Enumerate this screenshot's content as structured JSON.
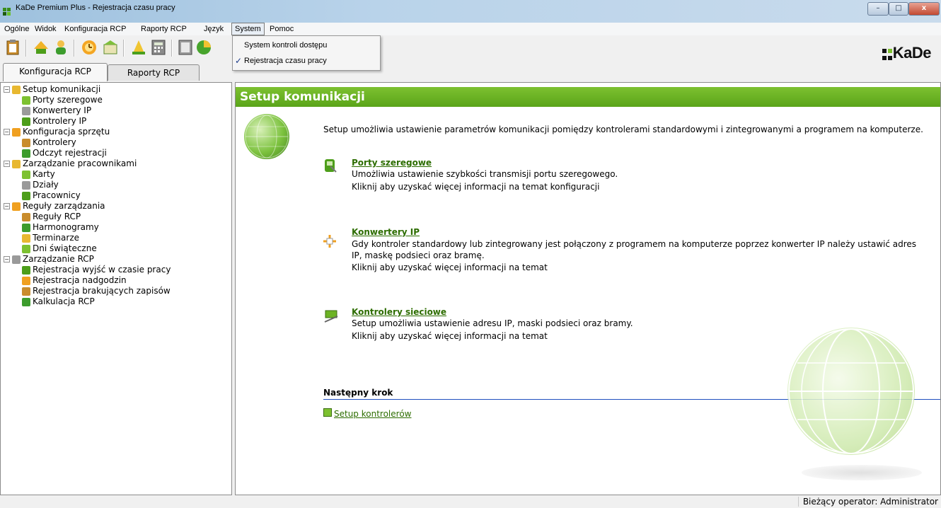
{
  "window": {
    "title": "KaDe Premium Plus - Rejestracja czasu pracy",
    "minimize": "–",
    "maximize": "□",
    "close": "x"
  },
  "menu": {
    "items": [
      "Ogólne",
      "Widok",
      "Konfiguracja RCP",
      "Raporty RCP",
      "Język",
      "System",
      "Pomoc"
    ],
    "open_item": "System",
    "dropdown": [
      {
        "label": "System kontroli dostępu",
        "checked": false
      },
      {
        "label": "Rejestracja czasu pracy",
        "checked": true,
        "check_mark": "✓"
      }
    ]
  },
  "logo": {
    "text": "KaDe"
  },
  "tabs": [
    {
      "label": "Konfiguracja RCP",
      "active": true
    },
    {
      "label": "Raporty RCP",
      "active": false
    }
  ],
  "tree": [
    {
      "label": "Setup komunikacji",
      "level": 0,
      "expander": "⊟",
      "icon": "globe-icon"
    },
    {
      "label": "Porty szeregowe",
      "level": 1,
      "icon": "serial-port-icon"
    },
    {
      "label": "Konwertery IP",
      "level": 1,
      "icon": "converter-icon"
    },
    {
      "label": "Kontrolery IP",
      "level": 1,
      "icon": "ip-controller-icon"
    },
    {
      "label": "Konfiguracja sprzętu",
      "level": 0,
      "expander": "⊟",
      "icon": "hardware-icon"
    },
    {
      "label": "Kontrolery",
      "level": 1,
      "icon": "controller-icon"
    },
    {
      "label": "Odczyt rejestracji",
      "level": 1,
      "icon": "read-registrations-icon"
    },
    {
      "label": "Zarządzanie pracownikami",
      "level": 0,
      "expander": "⊟",
      "icon": "people-icon"
    },
    {
      "label": "Karty",
      "level": 1,
      "icon": "cards-icon"
    },
    {
      "label": "Działy",
      "level": 1,
      "icon": "departments-icon"
    },
    {
      "label": "Pracownicy",
      "level": 1,
      "icon": "employees-icon"
    },
    {
      "label": "Reguły zarządzania",
      "level": 0,
      "expander": "⊟",
      "icon": "rules-icon"
    },
    {
      "label": "Reguły RCP",
      "level": 1,
      "icon": "rcp-rules-icon"
    },
    {
      "label": "Harmonogramy",
      "level": 1,
      "icon": "schedule-icon"
    },
    {
      "label": "Terminarze",
      "level": 1,
      "icon": "calendar-icon"
    },
    {
      "label": "Dni świąteczne",
      "level": 1,
      "icon": "holidays-icon"
    },
    {
      "label": "Zarządzanie RCP",
      "level": 0,
      "expander": "⊟",
      "icon": "chart-icon"
    },
    {
      "label": "Rejestracja wyjść w czasie pracy",
      "level": 1,
      "icon": "exits-icon"
    },
    {
      "label": "Rejestracja nadgodzin",
      "level": 1,
      "icon": "overtime-icon"
    },
    {
      "label": "Rejestracja brakujących zapisów",
      "level": 1,
      "icon": "missing-records-icon"
    },
    {
      "label": "Kalkulacja RCP",
      "level": 1,
      "icon": "calculator-icon"
    }
  ],
  "content": {
    "header": "Setup komunikacji",
    "intro": "Setup umożliwia ustawienie parametrów komunikacji pomiędzy kontrolerami standardowymi i zintegrowanymi a programem na komputerze.",
    "sections": [
      {
        "link": "Porty szeregowe",
        "desc1": "Umożliwia ustawienie szybkości transmisji portu szeregowego.",
        "desc2": "Kliknij aby uzyskać więcej informacji na temat konfiguracji"
      },
      {
        "link": "Konwertery IP",
        "desc1": "Gdy kontroler standardowy lub zintegrowany jest połączony z programem na komputerze poprzez konwerter IP należy ustawić adres",
        "desc1b": "IP, maskę podsieci oraz bramę.",
        "desc2": "Kliknij aby uzyskać więcej informacji na temat"
      },
      {
        "link": "Kontrolery sieciowe",
        "desc1": "Setup umożliwia ustawienie adresu IP, maski podsieci oraz bramy.",
        "desc2": "Kliknij aby uzyskać więcej informacji na temat"
      }
    ],
    "next_step_label": "Następny krok",
    "next_step_link": "Setup kontrolerów"
  },
  "status": {
    "operator": "Bieżący operator: Administrator"
  },
  "colors": {
    "accent_green": "#6cb324",
    "link_green": "#2d6d00",
    "divider_blue": "#1f4fbf"
  }
}
